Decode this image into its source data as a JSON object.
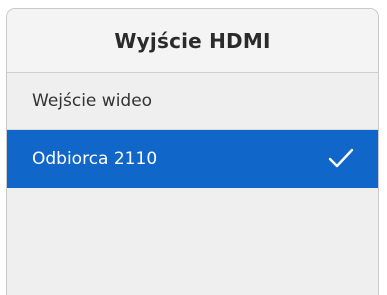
{
  "header": {
    "title": "Wyjście HDMI"
  },
  "options": [
    {
      "label": "Wejście wideo",
      "selected": false
    },
    {
      "label": "Odbiorca 2110",
      "selected": true,
      "icon": "checkmark-icon"
    }
  ],
  "colors": {
    "selected_background": "#1066c9",
    "panel_background": "#efefef"
  }
}
